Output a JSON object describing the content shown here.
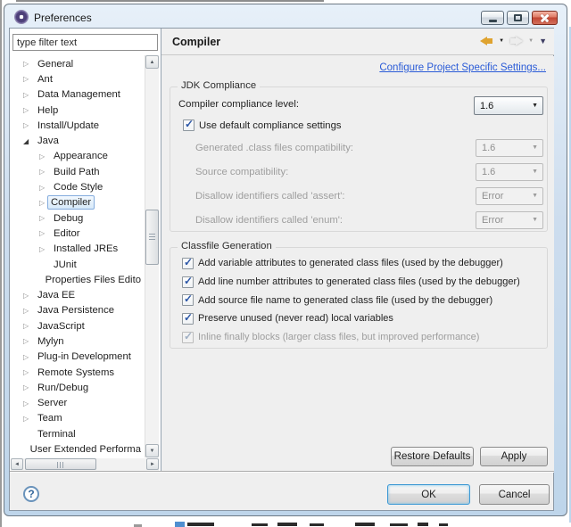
{
  "window": {
    "title": "Preferences"
  },
  "sidebar": {
    "filter_text": "type filter text",
    "tree": [
      {
        "label": "General",
        "level": 0,
        "state": "collapsed"
      },
      {
        "label": "Ant",
        "level": 0,
        "state": "collapsed"
      },
      {
        "label": "Data Management",
        "level": 0,
        "state": "collapsed"
      },
      {
        "label": "Help",
        "level": 0,
        "state": "collapsed"
      },
      {
        "label": "Install/Update",
        "level": 0,
        "state": "collapsed"
      },
      {
        "label": "Java",
        "level": 0,
        "state": "expanded"
      },
      {
        "label": "Appearance",
        "level": 1,
        "state": "collapsed"
      },
      {
        "label": "Build Path",
        "level": 1,
        "state": "collapsed"
      },
      {
        "label": "Code Style",
        "level": 1,
        "state": "collapsed"
      },
      {
        "label": "Compiler",
        "level": 1,
        "state": "collapsed",
        "selected": true
      },
      {
        "label": "Debug",
        "level": 1,
        "state": "collapsed"
      },
      {
        "label": "Editor",
        "level": 1,
        "state": "collapsed"
      },
      {
        "label": "Installed JREs",
        "level": 1,
        "state": "collapsed"
      },
      {
        "label": "JUnit",
        "level": 1,
        "state": "leaf"
      },
      {
        "label": "Properties Files Edito",
        "level": 1,
        "state": "leaf"
      },
      {
        "label": "Java EE",
        "level": 0,
        "state": "collapsed"
      },
      {
        "label": "Java Persistence",
        "level": 0,
        "state": "collapsed"
      },
      {
        "label": "JavaScript",
        "level": 0,
        "state": "collapsed"
      },
      {
        "label": "Mylyn",
        "level": 0,
        "state": "collapsed"
      },
      {
        "label": "Plug-in Development",
        "level": 0,
        "state": "collapsed"
      },
      {
        "label": "Remote Systems",
        "level": 0,
        "state": "collapsed"
      },
      {
        "label": "Run/Debug",
        "level": 0,
        "state": "collapsed"
      },
      {
        "label": "Server",
        "level": 0,
        "state": "collapsed"
      },
      {
        "label": "Team",
        "level": 0,
        "state": "collapsed"
      },
      {
        "label": "Terminal",
        "level": 0,
        "state": "leaf"
      },
      {
        "label": "User Extended Performa",
        "level": 0,
        "state": "leaf"
      }
    ]
  },
  "page": {
    "title": "Compiler",
    "link_label": "Configure Project Specific Settings...",
    "jdk": {
      "title": "JDK Compliance",
      "compliance_label": "Compiler compliance level:",
      "compliance_value": "1.6",
      "use_default_label": "Use default compliance settings",
      "use_default_checked": true,
      "rows": [
        {
          "label": "Generated .class files compatibility:",
          "value": "1.6",
          "enabled": false
        },
        {
          "label": "Source compatibility:",
          "value": "1.6",
          "enabled": false
        },
        {
          "label": "Disallow identifiers called 'assert':",
          "value": "Error",
          "enabled": false
        },
        {
          "label": "Disallow identifiers called 'enum':",
          "value": "Error",
          "enabled": false
        }
      ]
    },
    "classfile": {
      "title": "Classfile Generation",
      "options": [
        {
          "label": "Add variable attributes to generated class files (used by the debugger)",
          "checked": true,
          "enabled": true
        },
        {
          "label": "Add line number attributes to generated class files (used by the debugger)",
          "checked": true,
          "enabled": true
        },
        {
          "label": "Add source file name to generated class file (used by the debugger)",
          "checked": true,
          "enabled": true
        },
        {
          "label": "Preserve unused (never read) local variables",
          "checked": true,
          "enabled": true
        },
        {
          "label": "Inline finally blocks (larger class files, but improved performance)",
          "checked": true,
          "enabled": false
        }
      ]
    },
    "action_buttons": {
      "restore_defaults": "Restore Defaults",
      "apply": "Apply"
    }
  },
  "footer": {
    "ok": "OK",
    "cancel": "Cancel"
  },
  "icons": {
    "window-icon": "gear",
    "minimize-icon": "dash",
    "maximize-icon": "square-outline",
    "close-icon": "x-cross",
    "back-icon": "gold-left-arrow",
    "back-menu-icon": "caret-down",
    "forward-icon": "gray-right-arrow",
    "forward-menu-icon": "caret-down",
    "view-menu-icon": "caret-down-dark",
    "tree-collapsed-icon": "outline-right-triangle",
    "tree-expanded-icon": "filled-corner-triangle",
    "checkbox-checked-icon": "checkmark",
    "help-icon": "question-mark-circle"
  },
  "colors": {
    "titlebar_top": "#e7f0f9",
    "titlebar_bottom": "#bed5ea",
    "close_button": "#c14330",
    "link": "#2a5bd7",
    "tree_selection_border": "#84acdd",
    "tree_selection_fill": "#d7e9f9",
    "checkmark": "#2b56a7",
    "disabled_text": "#9e9e9e",
    "default_button_border": "#3c98d4",
    "panel_background": "#efefef"
  }
}
